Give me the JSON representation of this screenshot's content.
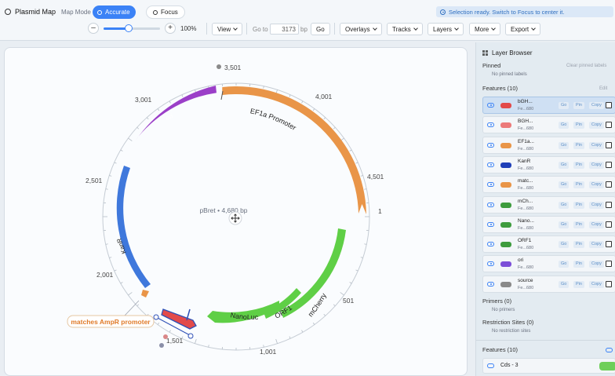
{
  "app": {
    "title": "Plasmid Map",
    "mode_label": "Map Mode"
  },
  "modes": {
    "accurate": "Accurate",
    "focus": "Focus"
  },
  "status": "Selection ready. Switch to Focus to center it.",
  "zoom": {
    "minus": "–",
    "plus": "+",
    "percent": "100%",
    "level": 0.45
  },
  "toolbar": {
    "view": "View",
    "goto_label": "Go to",
    "goto_value": "3173",
    "bp_label": "bp",
    "go": "Go",
    "overlays": "Overlays",
    "tracks": "Tracks",
    "layers": "Layers",
    "more": "More",
    "export": "Export"
  },
  "map": {
    "center_label": "pBret • 4,680 bp",
    "ticks": [
      "3,501",
      "4,001",
      "4,501",
      "1",
      "501",
      "1,001",
      "1,501",
      "2,001",
      "2,501",
      "3,001"
    ],
    "features": [
      {
        "name": "EF1a Promoter",
        "color": "#e99548"
      },
      {
        "name": "ori",
        "color": "#9b3fc8"
      },
      {
        "name": "KanR",
        "color": "#3f78dc"
      },
      {
        "name": "mCherry",
        "color": "#5fcf46"
      },
      {
        "name": "ORF1",
        "color": "#5fcf46"
      },
      {
        "name": "NanoLuc",
        "color": "#5fcf46"
      }
    ],
    "callout": "matches AmpR promoter"
  },
  "sidebar": {
    "title": "Layer Browser",
    "pinned": {
      "label": "Pinned",
      "action": "Clear pinned labels",
      "empty": "No pinned labels"
    },
    "features_label": "Features (10)",
    "features_action": "Edit",
    "row_actions": {
      "go": "Go",
      "pin": "Pin",
      "copy": "Copy"
    },
    "features": [
      {
        "name": "bGH...",
        "sub": "Fe...680",
        "color": "#e24a4a"
      },
      {
        "name": "BGH...",
        "sub": "Fe...680",
        "color": "#ec7a7a"
      },
      {
        "name": "EF1a...",
        "sub": "Fe...680",
        "color": "#e99548"
      },
      {
        "name": "KanR",
        "sub": "Fe...680",
        "color": "#1f3fb8"
      },
      {
        "name": "matc...",
        "sub": "Fe...680",
        "color": "#e99548"
      },
      {
        "name": "mCh...",
        "sub": "Fe...680",
        "color": "#3e9c3e"
      },
      {
        "name": "Nano...",
        "sub": "Fe...680",
        "color": "#3e9c3e"
      },
      {
        "name": "ORF1",
        "sub": "Fe...680",
        "color": "#3e9c3e"
      },
      {
        "name": "ori",
        "sub": "Fe...680",
        "color": "#7c4fd8"
      },
      {
        "name": "source",
        "sub": "Fe...680",
        "color": "#8a8a8a"
      }
    ],
    "primers": {
      "label": "Primers (0)",
      "empty": "No primers"
    },
    "restriction": {
      "label": "Restriction Sites (0)",
      "empty": "No restriction sites"
    },
    "features2_label": "Features (10)",
    "cds": {
      "name": "Cds - 3"
    }
  }
}
